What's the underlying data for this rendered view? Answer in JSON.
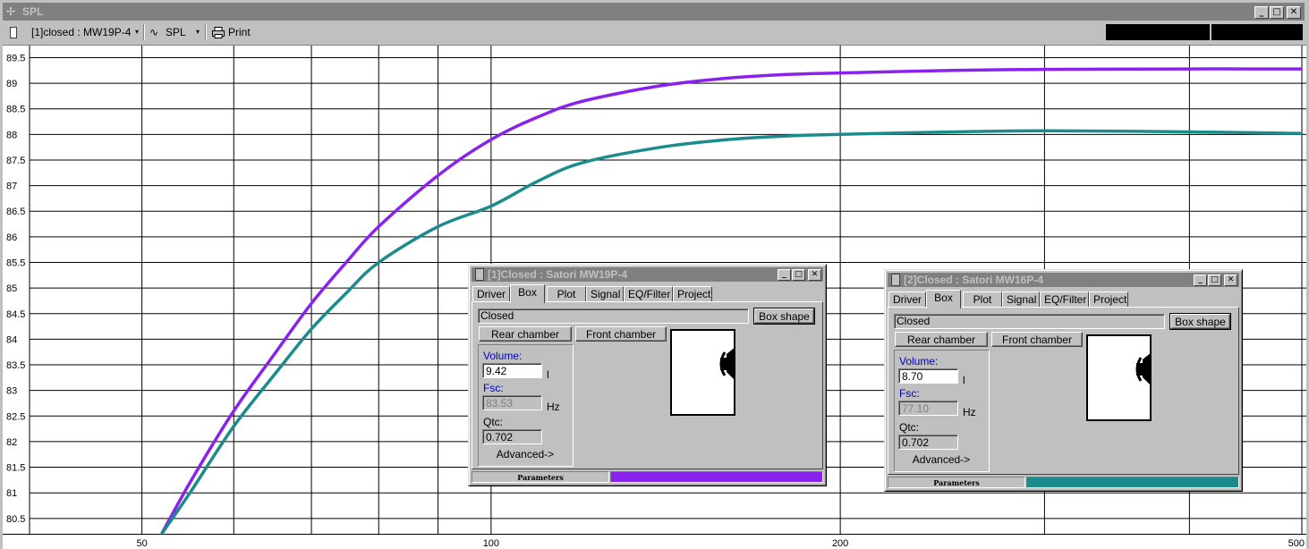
{
  "window": {
    "title": "SPL",
    "minimize": "_",
    "maximize": "□",
    "close": "✕"
  },
  "toolbar": {
    "driver_combo": "[1]closed : MW19P-4",
    "graph_combo": "SPL",
    "print_label": "Print",
    "combo_arrow": "▾"
  },
  "plot": {
    "y_ticks": [
      "89.5",
      "89",
      "88.5",
      "88",
      "87.5",
      "87",
      "86.5",
      "86",
      "85.5",
      "85",
      "84.5",
      "84",
      "83.5",
      "83",
      "82.5",
      "82",
      "81.5",
      "81",
      "80.5"
    ],
    "x_ticks": [
      "50",
      "100",
      "200",
      "500"
    ],
    "colors": {
      "series1": "#8a22ee",
      "series2": "#1b8b8b"
    }
  },
  "chart_data": {
    "type": "line",
    "title": "",
    "xlabel": "",
    "ylabel": "",
    "x_scale": "log",
    "xlim": [
      40,
      500
    ],
    "ylim": [
      80.2,
      89.7
    ],
    "grid": true,
    "series": [
      {
        "name": "[1]Closed : Satori MW19P-4",
        "color": "#8a22ee",
        "x": [
          52,
          55,
          60,
          65,
          70,
          75,
          80,
          90,
          100,
          110,
          120,
          140,
          160,
          180,
          200,
          250,
          300,
          400,
          500
        ],
        "y": [
          80.2,
          81.2,
          82.6,
          83.7,
          84.7,
          85.5,
          86.2,
          87.2,
          87.9,
          88.35,
          88.65,
          88.95,
          89.1,
          89.17,
          89.2,
          89.25,
          89.27,
          89.28,
          89.28
        ]
      },
      {
        "name": "[2]Closed : Satori MW16P-4",
        "color": "#1b8b8b",
        "x": [
          52,
          55,
          60,
          65,
          70,
          75,
          80,
          90,
          100,
          110,
          120,
          140,
          160,
          180,
          200,
          250,
          300,
          400,
          500
        ],
        "y": [
          80.2,
          81.0,
          82.3,
          83.3,
          84.2,
          84.9,
          85.5,
          86.2,
          86.6,
          87.1,
          87.45,
          87.75,
          87.9,
          87.97,
          88.0,
          88.05,
          88.07,
          88.05,
          88.02
        ]
      }
    ]
  },
  "dialogs": [
    {
      "title": "[1]Closed : Satori MW19P-4",
      "tabs": [
        "Driver",
        "Box",
        "Plot",
        "Signal",
        "EQ/Filter",
        "Project"
      ],
      "active_tab": "Box",
      "type_field": "Closed",
      "box_shape_button": "Box shape",
      "rear_chamber_button": "Rear chamber",
      "front_chamber_button": "Front chamber",
      "volume_label": "Volume:",
      "volume_value": "9.42",
      "volume_unit": "l",
      "fsc_label": "Fsc:",
      "fsc_value": "83.53",
      "fsc_unit": "Hz",
      "qtc_label": "Qtc:",
      "qtc_value": "0.702",
      "advanced_button": "Advanced->",
      "status_label": "Parameters",
      "color": "#8a22ee"
    },
    {
      "title": "[2]Closed : Satori MW16P-4",
      "tabs": [
        "Driver",
        "Box",
        "Plot",
        "Signal",
        "EQ/Filter",
        "Project"
      ],
      "active_tab": "Box",
      "type_field": "Closed",
      "box_shape_button": "Box shape",
      "rear_chamber_button": "Rear chamber",
      "front_chamber_button": "Front chamber",
      "volume_label": "Volume:",
      "volume_value": "8.70",
      "volume_unit": "l",
      "fsc_label": "Fsc:",
      "fsc_value": "77.10",
      "fsc_unit": "Hz",
      "qtc_label": "Qtc:",
      "qtc_value": "0.702",
      "advanced_button": "Advanced->",
      "status_label": "Parameters",
      "color": "#1b8b8b"
    }
  ]
}
